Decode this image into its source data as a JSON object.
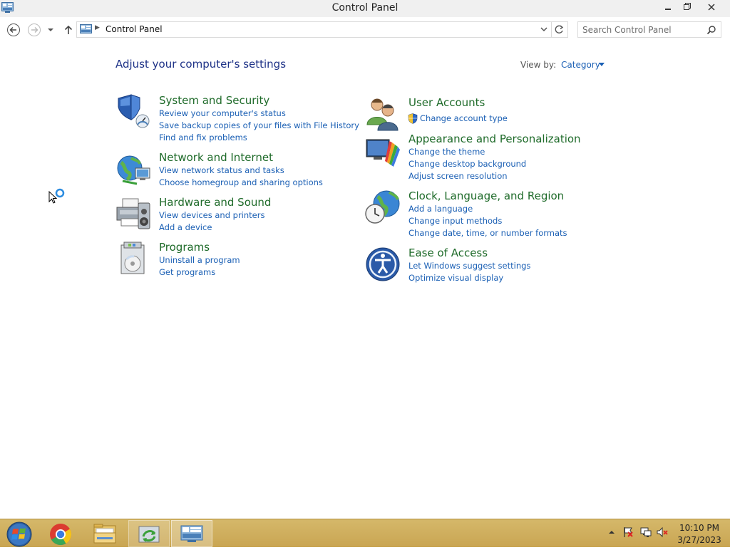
{
  "window": {
    "title": "Control Panel"
  },
  "nav": {
    "breadcrumb": "Control Panel",
    "search_placeholder": "Search Control Panel"
  },
  "main": {
    "heading": "Adjust your computer's settings",
    "view_by_label": "View by:",
    "view_by_value": "Category"
  },
  "categories": [
    {
      "title": "System and Security",
      "links": [
        "Review your computer's status",
        "Save backup copies of your files with File History",
        "Find and fix problems"
      ],
      "icon": "shield-icon"
    },
    {
      "title": "Network and Internet",
      "links": [
        "View network status and tasks",
        "Choose homegroup and sharing options"
      ],
      "icon": "network-globe-icon"
    },
    {
      "title": "Hardware and Sound",
      "links": [
        "View devices and printers",
        "Add a device"
      ],
      "icon": "printer-speaker-icon"
    },
    {
      "title": "Programs",
      "links": [
        "Uninstall a program",
        "Get programs"
      ],
      "icon": "programs-disc-icon"
    },
    {
      "title": "User Accounts",
      "links": [
        "Change account type"
      ],
      "icon": "users-icon"
    },
    {
      "title": "Appearance and Personalization",
      "links": [
        "Change the theme",
        "Change desktop background",
        "Adjust screen resolution"
      ],
      "icon": "monitor-palette-icon"
    },
    {
      "title": "Clock, Language, and Region",
      "links": [
        "Add a language",
        "Change input methods",
        "Change date, time, or number formats"
      ],
      "icon": "globe-clock-icon"
    },
    {
      "title": "Ease of Access",
      "links": [
        "Let Windows suggest settings",
        "Optimize visual display"
      ],
      "icon": "accessibility-icon"
    }
  ],
  "taskbar": {
    "time": "10:10 PM",
    "date": "3/27/2023"
  },
  "colors": {
    "category_title": "#1f6b2a",
    "link": "#1a5fb4",
    "heading": "#1e3287",
    "taskbar": "#cfae5e"
  }
}
